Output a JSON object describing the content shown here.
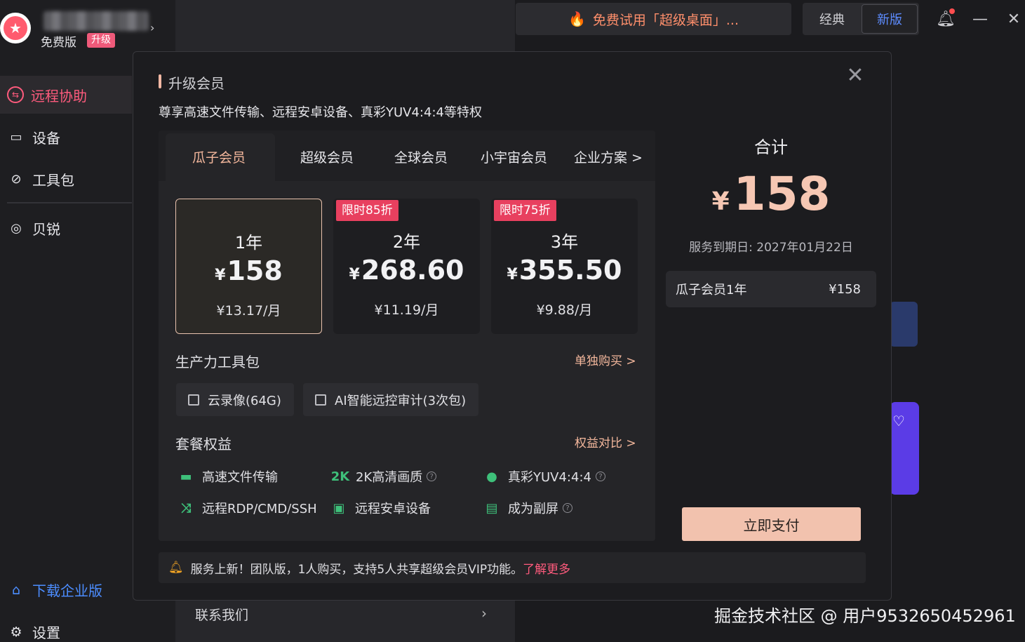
{
  "app": {
    "plan_label": "免费版",
    "upgrade_badge": "升级",
    "nav": [
      {
        "label": "远程协助",
        "icon": "remote-assist-icon"
      },
      {
        "label": "设备",
        "icon": "device-icon"
      },
      {
        "label": "工具包",
        "icon": "toolbox-icon"
      },
      {
        "label": "贝锐",
        "icon": "oray-icon"
      }
    ],
    "download_enterprise": "下载企业版",
    "settings": "设置",
    "contact_us": "联系我们",
    "promo_banner": "免费试用「超级桌面」...",
    "version_classic": "经典",
    "version_new": "新版",
    "watermark": "掘金技术社区 @ 用户9532650452961",
    "colors": {
      "accent_pink": "#ff5b7d",
      "accent_blue": "#5d8cff"
    }
  },
  "modal": {
    "title": "升级会员",
    "subtitle": "尊享高速文件传输、远程安卓设备、真彩YUV4:4:4等特权",
    "tabs": [
      {
        "label": "瓜子会员",
        "active": true
      },
      {
        "label": "超级会员",
        "active": false
      },
      {
        "label": "全球会员",
        "active": false
      },
      {
        "label": "小宇宙会员",
        "active": false
      },
      {
        "label": "企业方案 >",
        "active": false
      }
    ],
    "plans": [
      {
        "duration": "1年",
        "currency": "¥",
        "price": "158",
        "monthly": "¥13.17/月",
        "discount": "",
        "selected": true
      },
      {
        "duration": "2年",
        "currency": "¥",
        "price": "268.60",
        "monthly": "¥11.19/月",
        "discount": "限时85折",
        "selected": false
      },
      {
        "duration": "3年",
        "currency": "¥",
        "price": "355.50",
        "monthly": "¥9.88/月",
        "discount": "限时75折",
        "selected": false
      }
    ],
    "toolkit": {
      "label": "生产力工具包",
      "link": "单独购买 >",
      "addons": [
        {
          "label": "云录像(64G)",
          "checked": false
        },
        {
          "label": "AI智能远控审计(3次包)",
          "checked": false
        }
      ]
    },
    "benefits": {
      "label": "套餐权益",
      "link": "权益对比 >",
      "items": [
        {
          "label": "高速文件传输",
          "icon": "folder-icon",
          "glyph": "",
          "help": false
        },
        {
          "label": "2K高清画质",
          "icon": "2k-icon",
          "glyph": "2K",
          "help": true
        },
        {
          "label": "真彩YUV4:4:4",
          "icon": "palette-icon",
          "glyph": "",
          "help": true
        },
        {
          "label": "远程RDP/CMD/SSH",
          "icon": "terminal-icon",
          "glyph": "",
          "help": false
        },
        {
          "label": "远程安卓设备",
          "icon": "android-device-icon",
          "glyph": "",
          "help": false
        },
        {
          "label": "成为副屏",
          "icon": "second-screen-icon",
          "glyph": "",
          "help": true
        }
      ]
    },
    "notice": {
      "text": "服务上新！团队版，1人购买，支持5人共享超级会员VIP功能。",
      "link": "了解更多"
    },
    "summary": {
      "total_label": "合计",
      "currency": "¥",
      "total": "158",
      "expire": "服务到期日: 2027年01月22日",
      "line_item_name": "瓜子会员1年",
      "line_item_price": "¥158",
      "pay_button": "立即支付"
    },
    "colors": {
      "highlight": "#f3b79c",
      "discount_badge": "#e8405f",
      "benefit_icon": "#3ec07a"
    }
  }
}
